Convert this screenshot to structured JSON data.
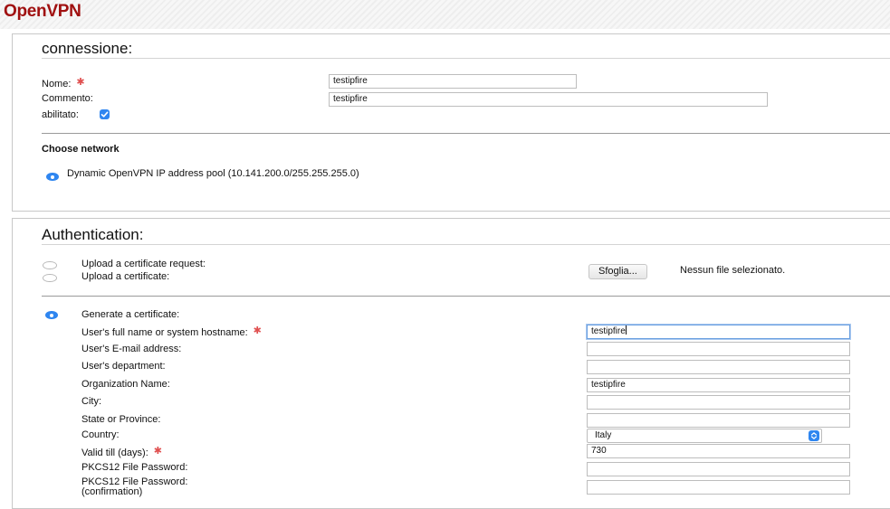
{
  "header": {
    "brand": "OpenVPN"
  },
  "connection": {
    "title": "connessione:",
    "name_label": "Nome:",
    "name_value": "testipfire",
    "comment_label": "Commento:",
    "comment_value": "testipfire",
    "enabled_label": "abilitato:",
    "enabled_checked": true,
    "network_heading": "Choose network",
    "network_option": "Dynamic OpenVPN IP address pool (10.141.200.0/255.255.255.0)"
  },
  "authentication": {
    "title": "Authentication:",
    "upload_request_label": "Upload a certificate request:",
    "upload_cert_label": "Upload a certificate:",
    "browse_button": "Sfoglia...",
    "no_file_text": "Nessun file selezionato.",
    "generate_label": "Generate a certificate:",
    "fields": {
      "fullname_label": "User's full name or system hostname:",
      "fullname_value": "testipfire",
      "email_label": "User's E-mail address:",
      "email_value": "",
      "department_label": "User's department:",
      "department_value": "",
      "org_label": "Organization Name:",
      "org_value": "testipfire",
      "city_label": "City:",
      "city_value": "",
      "state_label": "State or Province:",
      "state_value": "",
      "country_label": "Country:",
      "country_value": "Italy",
      "valid_label": "Valid till (days):",
      "valid_value": "730",
      "pkcs_label": "PKCS12 File Password:",
      "pkcs_value": "",
      "pkcs_confirm_label_line1": "PKCS12 File Password:",
      "pkcs_confirm_label_line2": "(confirmation)",
      "pkcs_confirm_value": ""
    }
  },
  "colors": {
    "brand": "#a01010",
    "accent": "#2f86f0",
    "required": "#e05050"
  },
  "icons": {
    "required": "asterisk-icon",
    "check": "checkmark-icon",
    "select": "select-arrows-icon"
  }
}
